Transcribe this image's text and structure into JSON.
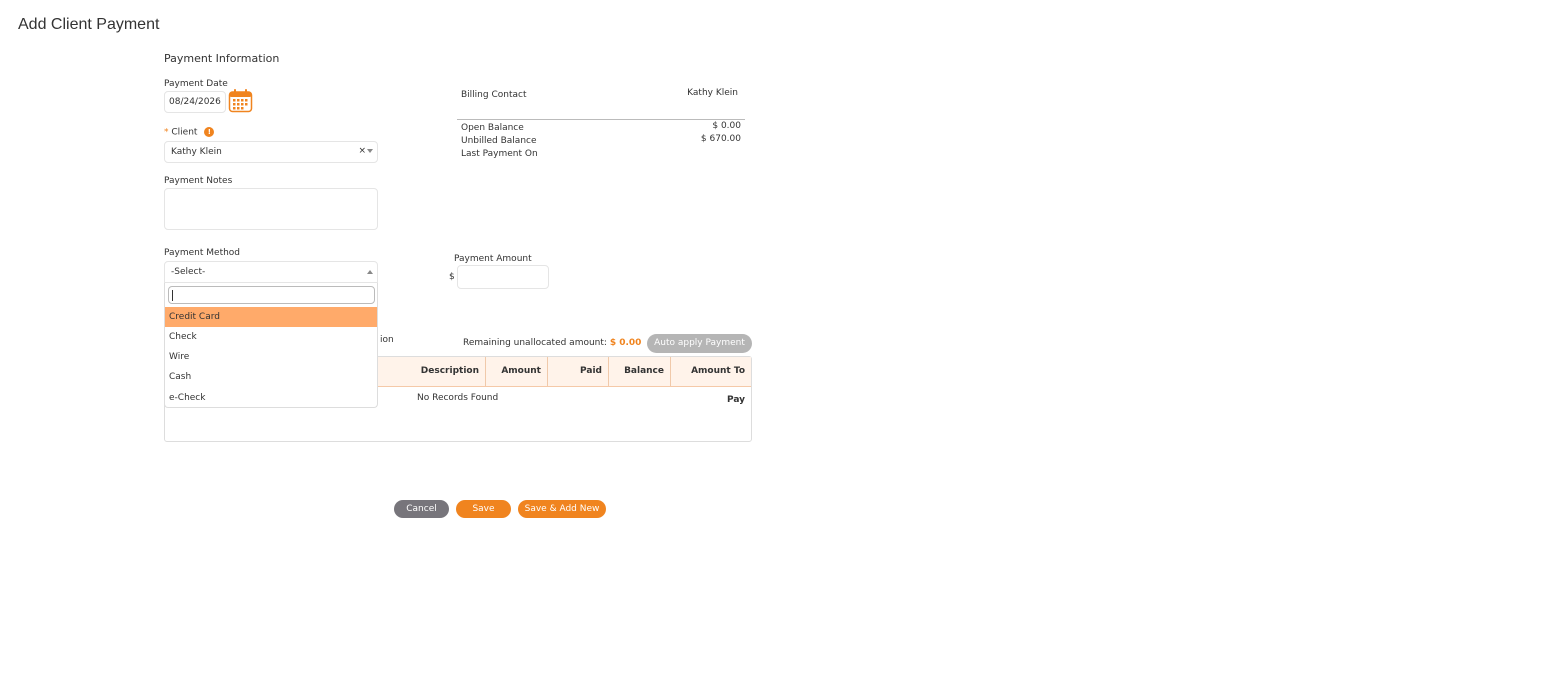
{
  "page": {
    "title": "Add Client Payment"
  },
  "payment_info": {
    "section_title": "Payment Information",
    "date_label": "Payment Date",
    "date_value": "08/24/2026",
    "client_label": "Client",
    "client_required_mark": "*",
    "client_value": "Kathy Klein",
    "client_clear": "×",
    "notes_label": "Payment Notes",
    "notes_value": "",
    "method_label": "Payment Method",
    "method_value": "-Select-",
    "method_options": [
      "Credit Card",
      "Check",
      "Wire",
      "Cash",
      "e-Check"
    ],
    "method_highlighted": "Credit Card",
    "amount_label": "Payment Amount",
    "currency_symbol": "$",
    "amount_value": ""
  },
  "billing": {
    "contact_label": "Billing Contact",
    "contact_value": "Kathy Klein",
    "open_balance_label": "Open Balance",
    "open_balance_value": "$ 0.00",
    "unbilled_label": "Unbilled Balance",
    "unbilled_value": "$ 670.00",
    "last_payment_label": "Last Payment On",
    "last_payment_value": ""
  },
  "allocation": {
    "partial_label": "ion",
    "remaining_label": "Remaining unallocated amount:",
    "remaining_value": "$ 0.00",
    "auto_apply_label": "Auto apply Payment",
    "columns": [
      "Description",
      "Amount",
      "Paid",
      "Balance",
      "Amount To Pay"
    ],
    "empty_text": "No Records Found"
  },
  "actions": {
    "cancel": "Cancel",
    "save": "Save",
    "save_new": "Save & Add New"
  },
  "colors": {
    "accent": "#f0841f",
    "highlight": "#ffaa6a",
    "disabled": "#b5b5b5",
    "cancel": "#77757b"
  }
}
